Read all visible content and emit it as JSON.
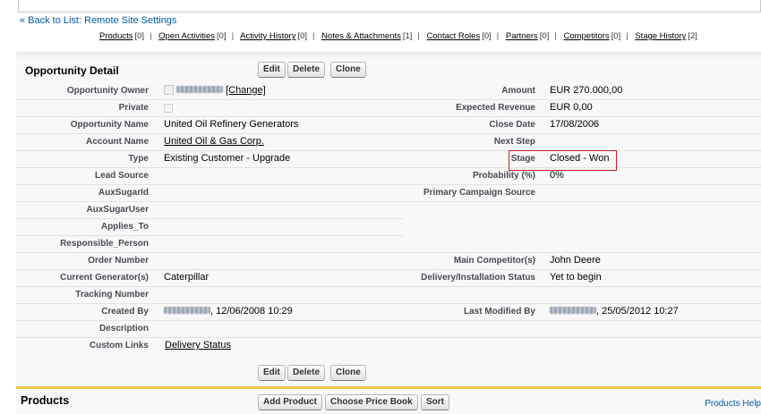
{
  "nav": {
    "back_link": "Back to List: Remote Site Settings",
    "related": [
      {
        "label": "Products",
        "count": "[0]"
      },
      {
        "label": "Open Activities",
        "count": "[0]"
      },
      {
        "label": "Activity History",
        "count": "[0]"
      },
      {
        "label": "Notes & Attachments",
        "count": "[1]"
      },
      {
        "label": "Contact Roles",
        "count": "[0]"
      },
      {
        "label": "Partners",
        "count": "[0]"
      },
      {
        "label": "Competitors",
        "count": "[0]"
      },
      {
        "label": "Stage History",
        "count": "[2]"
      }
    ],
    "separator": "|"
  },
  "detail": {
    "title": "Opportunity Detail",
    "buttons": {
      "edit": "Edit",
      "delete": "Delete",
      "clone": "Clone"
    },
    "fields": {
      "owner_label": "Opportunity Owner",
      "owner_change": "[Change]",
      "private_label": "Private",
      "name_label": "Opportunity Name",
      "name_value": "United Oil Refinery Generators",
      "account_label": "Account Name",
      "account_value": "United Oil & Gas Corp.",
      "type_label": "Type",
      "type_value": "Existing Customer - Upgrade",
      "lead_source_label": "Lead Source",
      "auxsugarid_label": "AuxSugarId",
      "auxsugaruser_label": "AuxSugarUser",
      "applies_to_label": "Applies_To",
      "responsible_label": "Responsible_Person",
      "order_number_label": "Order Number",
      "generators_label": "Current Generator(s)",
      "generators_value": "Caterpillar",
      "tracking_label": "Tracking Number",
      "created_by_label": "Created By",
      "created_by_value": ", 12/06/2008 10:29",
      "description_label": "Description",
      "custom_links_label": "Custom Links",
      "custom_links_value": "Delivery Status",
      "amount_label": "Amount",
      "amount_value": "EUR 270.000,00",
      "expected_revenue_label": "Expected Revenue",
      "expected_revenue_value": "EUR 0,00",
      "close_date_label": "Close Date",
      "close_date_value": "17/08/2006",
      "next_step_label": "Next Step",
      "stage_label": "Stage",
      "stage_value": "Closed - Won",
      "probability_label": "Probability (%)",
      "probability_value": "0%",
      "campaign_label": "Primary Campaign Source",
      "competitor_label": "Main Competitor(s)",
      "competitor_value": "John Deere",
      "delivery_label": "Delivery/Installation Status",
      "delivery_value": "Yet to begin",
      "modified_by_label": "Last Modified By",
      "modified_by_value": ", 25/05/2012 10:27"
    }
  },
  "products": {
    "title": "Products",
    "buttons": {
      "add": "Add Product",
      "price_book": "Choose Price Book",
      "sort": "Sort"
    },
    "help": "Products Help"
  },
  "colors": {
    "link": "#015ba7",
    "highlight_box": "#c0262d",
    "products_accent": "#e8c648"
  }
}
